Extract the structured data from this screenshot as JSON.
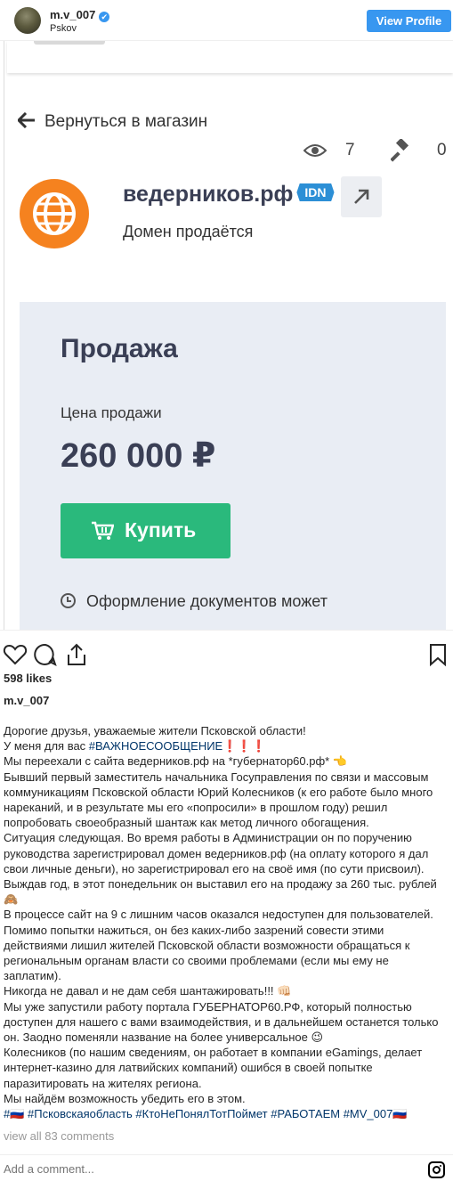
{
  "header": {
    "username": "m.v_007",
    "verified_glyph": "✔",
    "location": "Pskov",
    "view_profile": "View Profile"
  },
  "image": {
    "back_link": "Вернуться в магазин",
    "views_count": "7",
    "bids_count": "0",
    "domain_name": "ведерников.рф",
    "idn_badge": "IDN",
    "domain_status": "Домен продаётся",
    "sale_title": "Продажа",
    "price_label": "Цена продажи",
    "price": "260 000 ₽",
    "buy_button": "Купить",
    "docs_text": "Оформление документов может",
    "accent_orange": "#f5821f",
    "accent_green": "#2ab97c",
    "accent_blue": "#2c8fd6"
  },
  "actions": {
    "icons": [
      "heart-icon",
      "comment-icon",
      "share-icon",
      "bookmark-icon"
    ]
  },
  "likes": "598 likes",
  "author": "m.v_007",
  "caption": {
    "l1": "Дорогие друзья, уважаемые жители Псковской области!",
    "l2a": "У меня для вас ",
    "l2tag": "#ВАЖНОЕСООБЩЕНИЕ",
    "l2excl": "❗❗❗",
    "l3": "Мы переехали с сайта ведерников.рф на *губернатор60.рф* 👈",
    "l4": "Бывший первый заместитель начальника Госуправления по связи и массовым",
    "l5": "коммуникациям Псковской области Юрий Колесников (к его работе было много",
    "l6": "нареканий, и в результате мы его «попросили» в прошлом году) решил",
    "l7": "попробовать своеобразный шантаж как метод личного обогащения.",
    "l8": "Ситуация следующая. Во время работы в Администрации он по поручению",
    "l9": "руководства зарегистрировал домен ведерников.рф (на оплату которого я дал",
    "l10": "свои личные деньги), но зарегистрировал его на своё имя (по сути присвоил).",
    "l11": "Выждав год, в этот понедельник он выставил его на продажу за 260 тыс. рублей",
    "l12": "🙈",
    "l13": "В процессе сайт на 9 с лишним часов оказался недоступен для пользователей.",
    "l14": "Помимо попытки нажиться, он без каких-либо зазрений совести этими",
    "l15": "действиями лишил жителей Псковской области возможности обращаться к",
    "l16": "региональным органам власти со своими проблемами (если мы ему не",
    "l17": "заплатим).",
    "l18": "Никогда не давал и не дам себя шантажировать!!! 👊🏻",
    "l19": "Мы уже запустили работу портала ГУБЕРНАТОР60.РФ, который полностью",
    "l20": "доступен для нашего с вами взаимодействия, и в дальнейшем останется только",
    "l21": "он. Заодно поменяли название на более универсальное 😉",
    "l22": "Колесников (по нашим сведениям, он работает в компании eGamings, делает",
    "l23": "интернет-казино для латвийских компаний) ошибся в своей попытке",
    "l24": "паразитировать на жителях региона.",
    "l25": "Мы найдём возможность убедить его в этом.",
    "tags": "#🇷🇺 #Псковскаяобласть #КтоНеПонялТотПоймет #РАБОТАЕМ #MV_007🇷🇺"
  },
  "comments_link": "view all 83 comments",
  "add_comment_placeholder": "Add a comment..."
}
